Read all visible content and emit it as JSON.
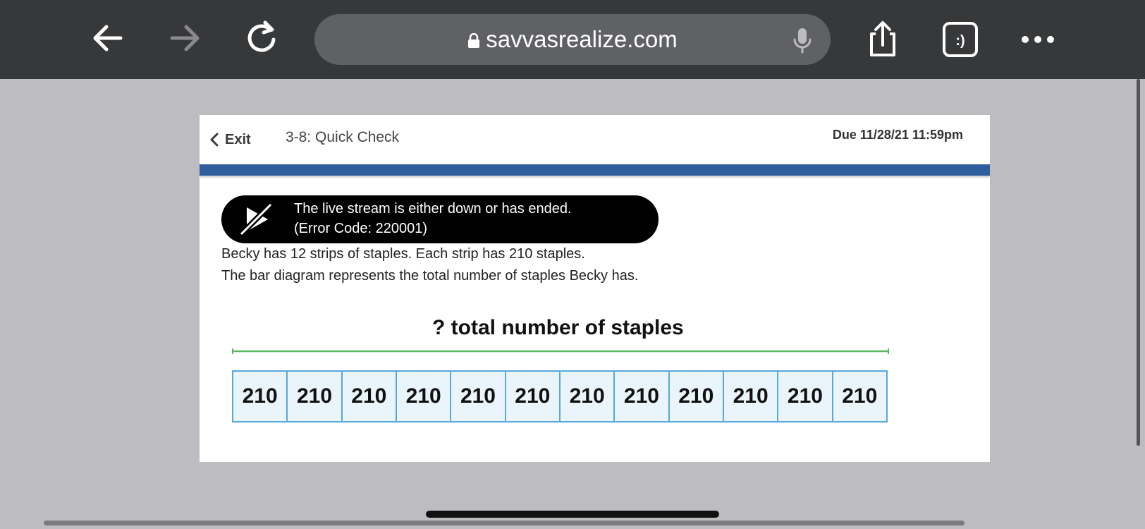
{
  "browser": {
    "url": "savvasrealize.com",
    "icons": [
      "back-arrow-icon",
      "forward-arrow-icon",
      "reload-icon",
      "lock-icon",
      "microphone-icon",
      "share-icon",
      "extension-icon",
      "more-icon"
    ],
    "extension_badge": ":)"
  },
  "assignment": {
    "exit_label": "Exit",
    "title": "3-8: Quick Check",
    "due": "Due 11/28/21 11:59pm"
  },
  "error_banner": {
    "line1": "The live stream is either down or has ended.",
    "line2": "(Error Code: 220001)"
  },
  "problem": {
    "line1": "Becky has 12 strips of staples. Each strip has 210 staples.",
    "line2": "The bar diagram represents the total number of staples Becky has."
  },
  "bar_diagram": {
    "label": "? total number of staples",
    "segments": [
      "210",
      "210",
      "210",
      "210",
      "210",
      "210",
      "210",
      "210",
      "210",
      "210",
      "210",
      "210"
    ]
  },
  "colors": {
    "toolbar": "#37383a",
    "url_pill": "#606164",
    "accent_blue": "#2e5f9c",
    "bracket_green": "#5cb85c",
    "cell_border": "#5aa8d8",
    "cell_fill": "#eaf4fb"
  }
}
